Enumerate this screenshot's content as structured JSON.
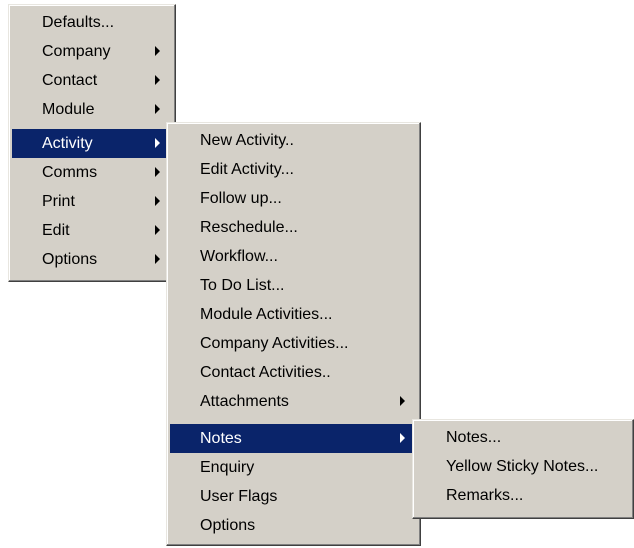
{
  "menu1": {
    "items": [
      {
        "label": "Defaults...",
        "submenu": false
      },
      {
        "label": "Company",
        "submenu": true
      },
      {
        "label": "Contact",
        "submenu": true
      },
      {
        "label": "Module",
        "submenu": true
      },
      {
        "label": "Activity",
        "submenu": true,
        "highlighted": true
      },
      {
        "label": "Comms",
        "submenu": true
      },
      {
        "label": "Print",
        "submenu": true
      },
      {
        "label": "Edit",
        "submenu": true
      },
      {
        "label": "Options",
        "submenu": true
      }
    ]
  },
  "menu2": {
    "items": [
      {
        "label": "New Activity..",
        "submenu": false
      },
      {
        "label": "Edit Activity...",
        "submenu": false
      },
      {
        "label": "Follow up...",
        "submenu": false
      },
      {
        "label": "Reschedule...",
        "submenu": false
      },
      {
        "label": "Workflow...",
        "submenu": false
      },
      {
        "label": "To Do List...",
        "submenu": false
      },
      {
        "label": "Module Activities...",
        "submenu": false
      },
      {
        "label": "Company Activities...",
        "submenu": false
      },
      {
        "label": "Contact Activities..",
        "submenu": false
      },
      {
        "label": "Attachments",
        "submenu": true
      },
      {
        "label": "Notes",
        "submenu": true,
        "highlighted": true
      },
      {
        "label": "Enquiry",
        "submenu": false
      },
      {
        "label": "User Flags",
        "submenu": false
      },
      {
        "label": "Options",
        "submenu": false
      }
    ]
  },
  "menu3": {
    "items": [
      {
        "label": "Notes...",
        "submenu": false
      },
      {
        "label": "Yellow Sticky Notes...",
        "submenu": false
      },
      {
        "label": "Remarks...",
        "submenu": false
      }
    ]
  },
  "colors": {
    "menu_bg": "#d4d0c8",
    "highlight_bg": "#0a246a",
    "highlight_text": "#ffffff"
  }
}
